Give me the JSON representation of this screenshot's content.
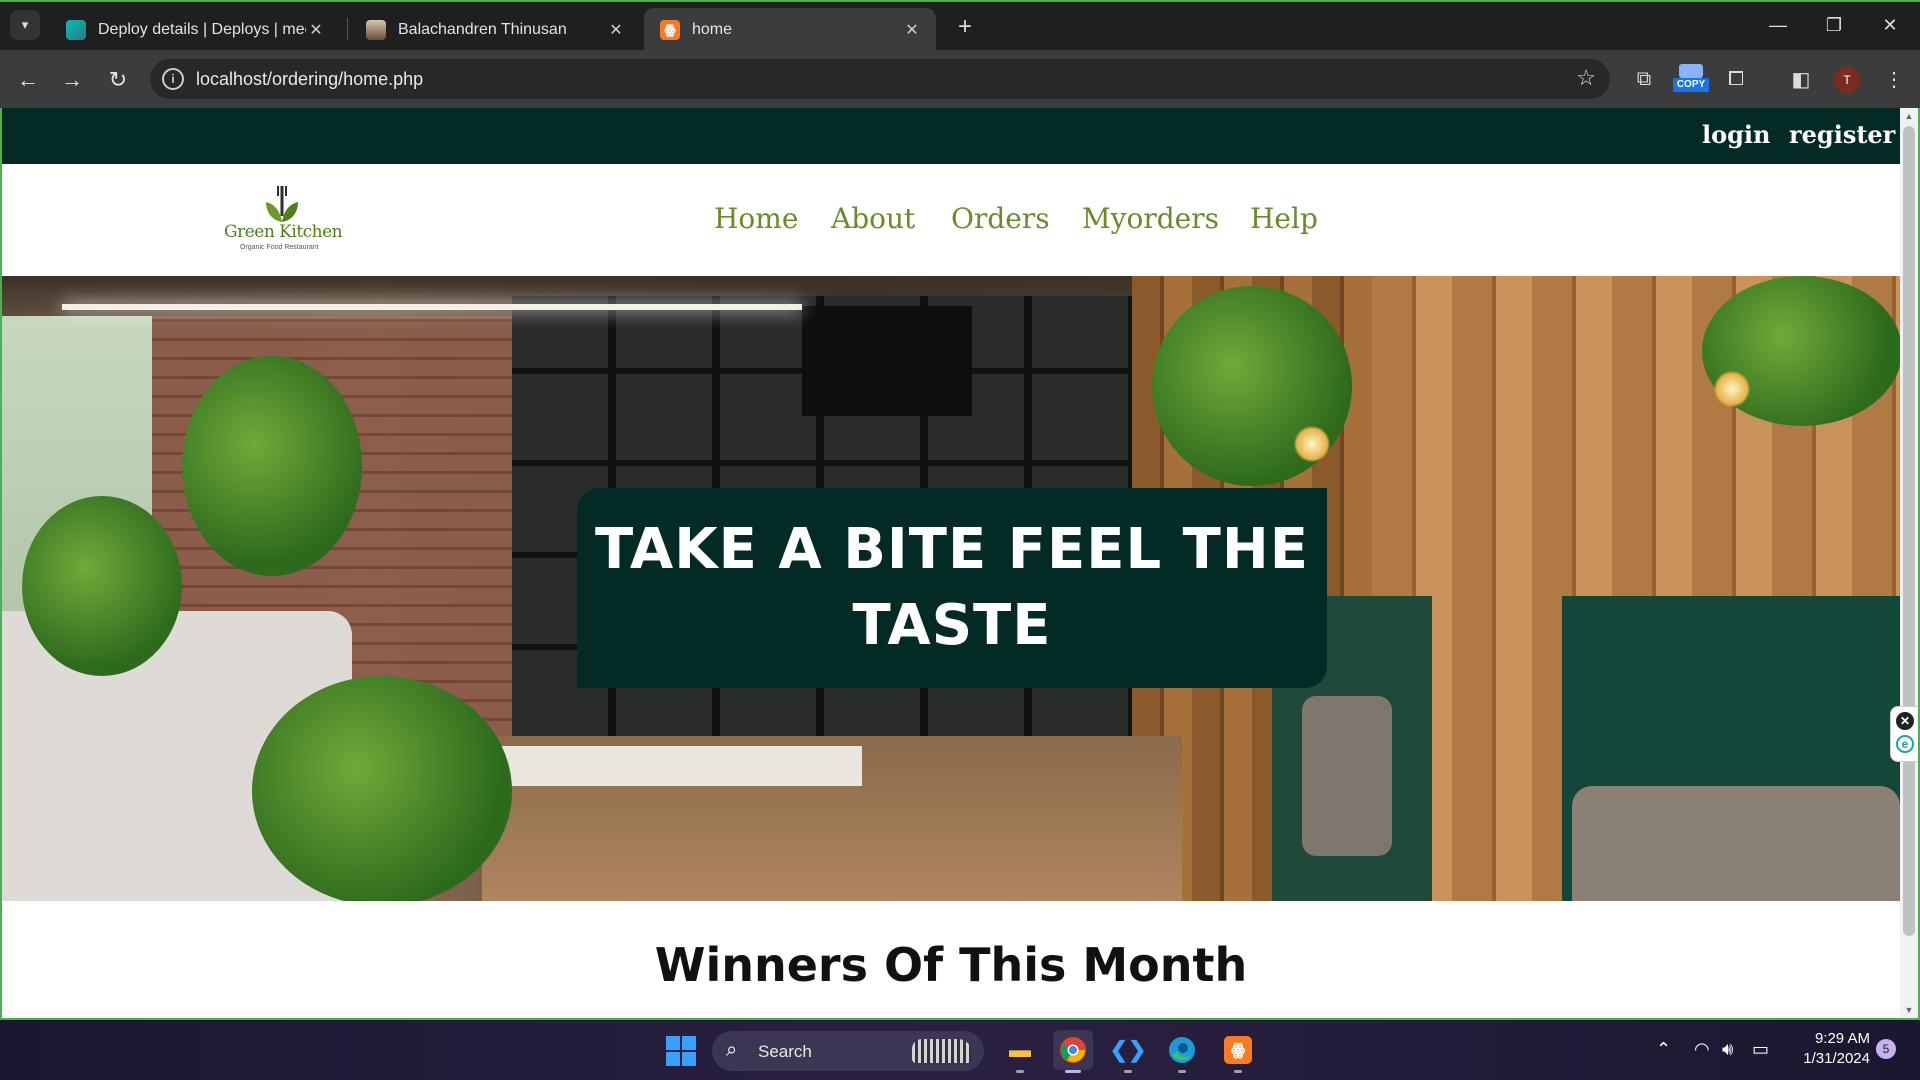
{
  "browser": {
    "tabs": [
      {
        "title": "Deploy details | Deploys | meek",
        "favicon": "netlify-icon",
        "active": false
      },
      {
        "title": "Balachandren Thinusan",
        "favicon": "profile-photo-icon",
        "active": false
      },
      {
        "title": "home",
        "favicon": "xampp-icon",
        "active": true
      }
    ],
    "url": "localhost/ordering/home.php",
    "copy_extension_label": "COPY",
    "profile_initial": "T"
  },
  "site": {
    "topbar": {
      "login": "login",
      "register": "register"
    },
    "logo": {
      "name": "Green Kitchen",
      "tagline": "Organic Food Restaurant"
    },
    "nav": [
      "Home",
      "About",
      "Orders",
      "Myorders",
      "Help"
    ],
    "hero": {
      "headline": "TAKE A BITE FEEL THE TASTE"
    },
    "section_title": "Winners Of This Month",
    "colors": {
      "dark_green": "#042a25",
      "nav_green": "#6b8a2a",
      "logo_green": "#4d7f1d"
    }
  },
  "taskbar": {
    "search_placeholder": "Search",
    "time": "9:29 AM",
    "date": "1/31/2024",
    "notification_count": "5"
  }
}
